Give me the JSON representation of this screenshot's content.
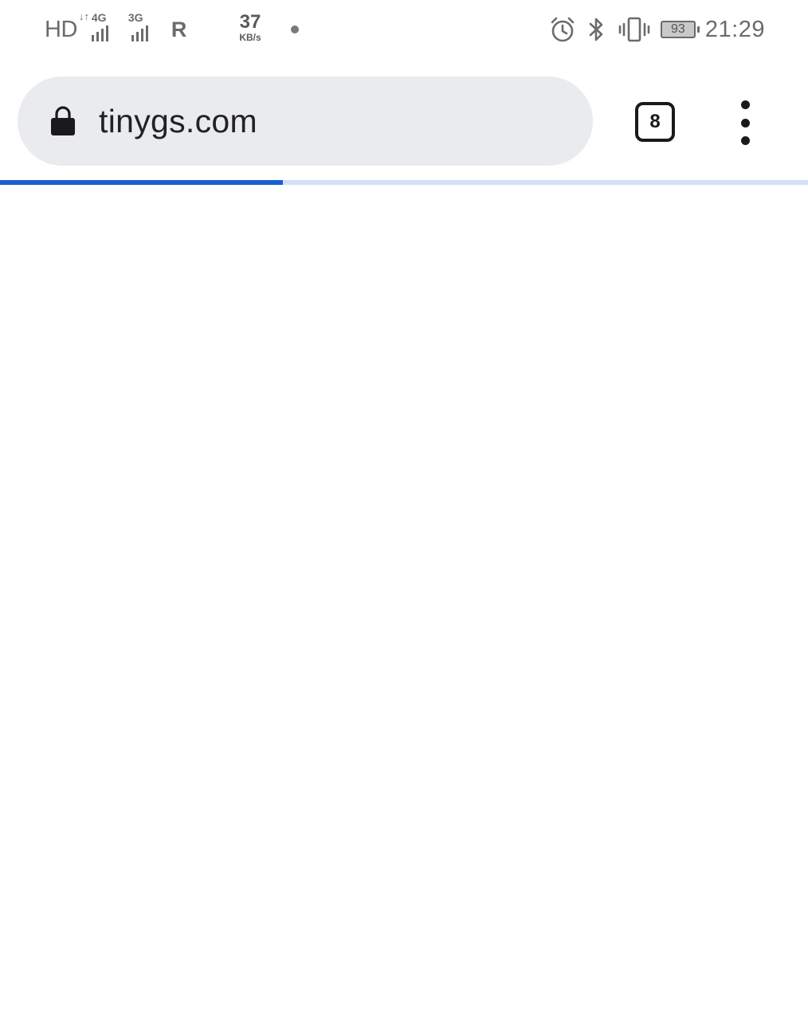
{
  "status_bar": {
    "hd_label": "HD",
    "network_1": {
      "type": "4G",
      "arrows": "↓↑"
    },
    "network_2": {
      "type": "3G"
    },
    "roaming_label": "R",
    "speed_value": "37",
    "speed_unit": "KB/s",
    "battery_level": "93",
    "time": "21:29",
    "icons": [
      "alarm-icon",
      "bluetooth-icon",
      "vibrate-icon",
      "battery-icon"
    ]
  },
  "toolbar": {
    "url": "tinygs.com",
    "secure_icon": "lock-icon",
    "tab_count": "8",
    "menu_icon": "more-vert-icon"
  },
  "progress": {
    "value": 0.35,
    "fill_color": "#1a5fd0",
    "track_color": "#d2e0f6"
  },
  "colors": {
    "omnibox_bg": "#e9ebee",
    "page_bg": "#ffffff"
  }
}
